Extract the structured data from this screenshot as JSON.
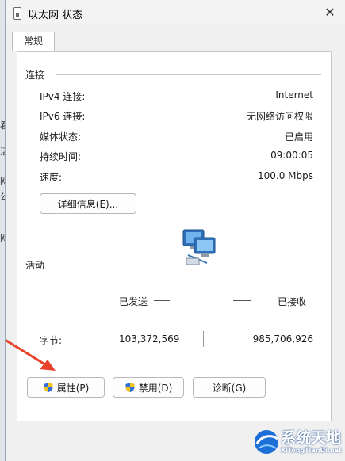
{
  "window": {
    "title": "以太网 状态",
    "close_symbol": "✕"
  },
  "tabs": [
    "常规"
  ],
  "connection": {
    "heading": "连接",
    "rows": [
      {
        "label": "IPv4 连接:",
        "value": "Internet"
      },
      {
        "label": "IPv6 连接:",
        "value": "无网络访问权限"
      },
      {
        "label": "媒体状态:",
        "value": "已启用"
      },
      {
        "label": "持续时间:",
        "value": "09:00:05"
      },
      {
        "label": "速度:",
        "value": "100.0 Mbps"
      }
    ],
    "details_button": "详细信息(E)..."
  },
  "activity": {
    "heading": "活动",
    "sent_label": "已发送",
    "received_label": "已接收",
    "bytes_label": "字节:",
    "bytes_sent": "103,372,569",
    "bytes_received": "985,706,926"
  },
  "buttons": {
    "properties": "属性(P)",
    "disable": "禁用(D)",
    "diagnose": "诊断(G)"
  },
  "watermark": {
    "text": "系统天地",
    "url_text": "XiTongTianDi.net"
  },
  "background_glyphs": [
    "看",
    "活",
    "网",
    "公",
    "网"
  ],
  "colors": {
    "arrow": "#e8412c",
    "shield_blue": "#2f6fd6",
    "shield_yellow": "#f2c318"
  }
}
